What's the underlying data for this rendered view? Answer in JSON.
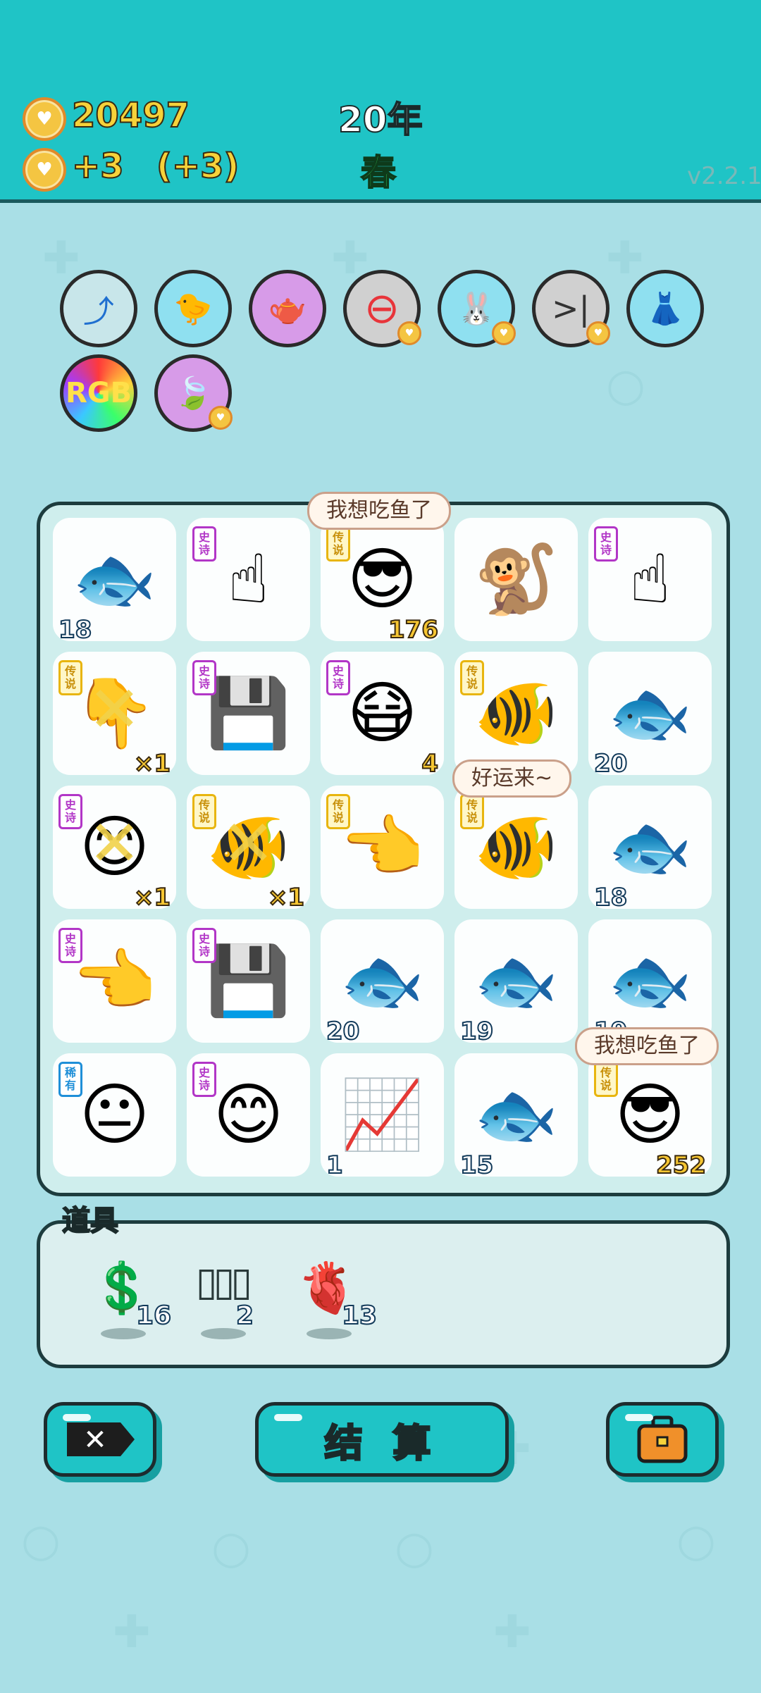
{
  "header": {
    "coins": "20497",
    "income": "+3",
    "income_bonus": "(+3)",
    "year": "20年",
    "season": "春",
    "version": "v2.2.1"
  },
  "abilities": [
    {
      "name": "arrow-card-icon",
      "glyph": "⤴",
      "bg": "#c8e6ea",
      "heart": false
    },
    {
      "name": "chick-egg-icon",
      "glyph": "🐤",
      "bg": "#8fe0f0",
      "heart": false
    },
    {
      "name": "gravy-boat-icon",
      "glyph": "🫖",
      "bg": "#d79be8",
      "heart": false
    },
    {
      "name": "minus-circle-icon",
      "glyph": "⊖",
      "bg": "#d0d0d0",
      "heart": true
    },
    {
      "name": "rabbit-icon",
      "glyph": "🐰",
      "bg": "#8fe0f0",
      "heart": true
    },
    {
      "name": "skip-icon",
      "glyph": ">|",
      "bg": "#d0d0d0",
      "heart": true
    },
    {
      "name": "skirt-icon",
      "glyph": "👗",
      "bg": "#8fe0f0",
      "heart": false
    },
    {
      "name": "rgb-icon",
      "glyph": "RGB",
      "bg": "#ff6a9a",
      "heart": false
    },
    {
      "name": "leaf-icon",
      "glyph": "🍃",
      "bg": "#d79be8",
      "heart": true
    }
  ],
  "board": [
    [
      {
        "name": "fish",
        "glyph": "🐟",
        "tag": "",
        "count": "18",
        "right": ""
      },
      {
        "name": "grey-finger",
        "glyph": "☝",
        "tag": "史诗",
        "count": "",
        "right": ""
      },
      {
        "name": "sunglasses-man",
        "glyph": "😎",
        "tag": "传说",
        "count": "",
        "right": "176"
      },
      {
        "name": "monkey",
        "glyph": "🐒",
        "tag": "",
        "count": "",
        "right": ""
      },
      {
        "name": "grey-finger",
        "glyph": "☝",
        "tag": "史诗",
        "count": "",
        "right": ""
      }
    ],
    [
      {
        "name": "gold-finger-crossed",
        "glyph": "👇",
        "tag": "传说",
        "count": "",
        "right": "×1"
      },
      {
        "name": "graphics-card",
        "glyph": "💾",
        "tag": "史诗",
        "count": "",
        "right": ""
      },
      {
        "name": "green-hat-man",
        "glyph": "😷",
        "tag": "史诗",
        "count": "",
        "right": "4"
      },
      {
        "name": "koi-fish",
        "glyph": "🐠",
        "tag": "传说",
        "count": "",
        "right": ""
      },
      {
        "name": "fish",
        "glyph": "🐟",
        "tag": "",
        "count": "20",
        "right": ""
      }
    ],
    [
      {
        "name": "yellow-face-crossed",
        "glyph": "😊",
        "tag": "史诗",
        "count": "",
        "right": "×1"
      },
      {
        "name": "koi-fish-crossed",
        "glyph": "🐠",
        "tag": "传说",
        "count": "",
        "right": "×1"
      },
      {
        "name": "gold-finger",
        "glyph": "👈",
        "tag": "传说",
        "count": "",
        "right": ""
      },
      {
        "name": "koi-fish",
        "glyph": "🐠",
        "tag": "传说",
        "count": "",
        "right": ""
      },
      {
        "name": "fish",
        "glyph": "🐟",
        "tag": "",
        "count": "18",
        "right": ""
      }
    ],
    [
      {
        "name": "grey-finger",
        "glyph": "👈",
        "tag": "史诗",
        "count": "",
        "right": ""
      },
      {
        "name": "graphics-card",
        "glyph": "💾",
        "tag": "史诗",
        "count": "",
        "right": ""
      },
      {
        "name": "fish",
        "glyph": "🐟",
        "tag": "",
        "count": "20",
        "right": ""
      },
      {
        "name": "fish",
        "glyph": "🐟",
        "tag": "",
        "count": "19",
        "right": ""
      },
      {
        "name": "fish",
        "glyph": "🐟",
        "tag": "",
        "count": "19",
        "right": ""
      }
    ],
    [
      {
        "name": "bucket-hat-man",
        "glyph": "😐",
        "tag": "稀有",
        "count": "",
        "right": ""
      },
      {
        "name": "yellow-face",
        "glyph": "😊",
        "tag": "史诗",
        "count": "",
        "right": ""
      },
      {
        "name": "trend-card",
        "glyph": "📈",
        "tag": "",
        "count": "1",
        "right": ""
      },
      {
        "name": "fish",
        "glyph": "🐟",
        "tag": "",
        "count": "15",
        "right": ""
      },
      {
        "name": "sunglasses-man",
        "glyph": "😎",
        "tag": "传说",
        "count": "",
        "right": "252"
      }
    ]
  ],
  "bubbles": {
    "b1": "我想吃鱼了",
    "b2": "好运来~",
    "b3": "我想吃鱼了"
  },
  "items": {
    "label": "道具",
    "list": [
      {
        "name": "dollar-coin-icon",
        "glyph": "💲",
        "qty": "16"
      },
      {
        "name": "triple-jar-icon",
        "glyph": "▯▯▯",
        "qty": "2"
      },
      {
        "name": "liver-icon",
        "glyph": "🫀",
        "qty": "13"
      }
    ]
  },
  "buttons": {
    "settle": "结 算"
  },
  "colors": {
    "header": "#1fc4c6",
    "background": "#a9dfe6",
    "coin": "#f4c542"
  }
}
